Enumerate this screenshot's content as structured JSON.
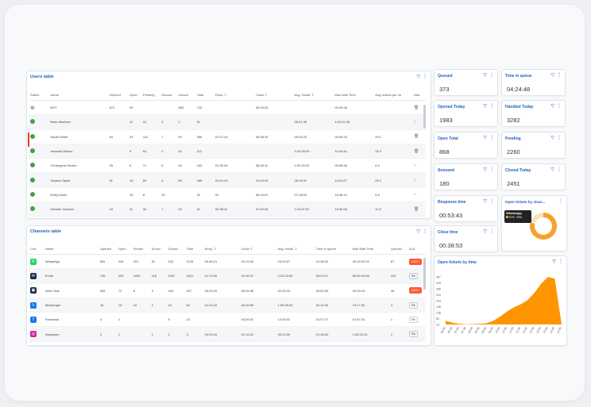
{
  "users_table": {
    "title": "Users table",
    "columns": [
      "Status",
      "Name",
      "Opened",
      "Open",
      "Pending",
      "Snooze",
      "Closed",
      "Total",
      "Resp. T.",
      "Close T.",
      "Avg. Handl. T.",
      "Max Wait Time",
      "Avg. tickets per ho",
      "Noti."
    ],
    "rows": [
      {
        "status": "globe",
        "name": "BOT",
        "opened": "672",
        "open": "50",
        "pending": "",
        "snooze": "",
        "closed": "655",
        "total": "710",
        "resp": "",
        "close": "00:15:25",
        "avg": "",
        "max": "00:30:26",
        "avgt": "",
        "noti": "trash"
      },
      {
        "status": "online",
        "name": "Brian Martinez",
        "opened": "",
        "open": "11",
        "pending": "31",
        "snooze": "4",
        "closed": "2",
        "total": "51",
        "resp": "",
        "close": "",
        "avg": "06:21:45",
        "max": "4:22:01:36",
        "avgt": "",
        "noti": "chat"
      },
      {
        "status": "online",
        "name": "Sarah White",
        "opened": "64",
        "open": "33",
        "pending": "141",
        "snooze": "7",
        "closed": "49",
        "total": "266",
        "resp": "01:07:44",
        "close": "00:58:19",
        "avg": "09:25:23",
        "max": "00:09:15",
        "avgt": "20.1",
        "noti": "trash"
      },
      {
        "status": "online",
        "name": "Amanda Wilson",
        "opened": "",
        "open": "9",
        "pending": "64",
        "snooze": "2",
        "closed": "34",
        "total": "112",
        "resp": "",
        "close": "",
        "avg": "3:18:29:25",
        "max": "11:04:44",
        "avgt": "28.3",
        "noti": "trash"
      },
      {
        "status": "online",
        "name": "Christopher Brown",
        "opened": "33",
        "open": "6",
        "pending": "71",
        "snooze": "5",
        "closed": "26",
        "total": "109",
        "resp": "01:30:54",
        "close": "08:28:12",
        "avg": "1:00:20:20",
        "max": "00:08:46",
        "avgt": "6.9",
        "noti": "chat"
      },
      {
        "status": "online",
        "name": "Jessica Taylor",
        "opened": "61",
        "open": "18",
        "pending": "83",
        "snooze": "4",
        "closed": "59",
        "total": "168",
        "resp": "00:41:40",
        "close": "01:04:49",
        "avg": "08:15:31",
        "max": "14:41:07",
        "avgt": "25.2",
        "noti": "chat"
      },
      {
        "status": "online",
        "name": "Emily Davis",
        "opened": "",
        "open": "15",
        "pending": "8",
        "snooze": "54",
        "closed": "",
        "total": "22",
        "resp": "92",
        "close": "00:15:07",
        "avg": "07:18:00",
        "max": "18:46:14",
        "avgt": "5.6",
        "noti": "chat"
      },
      {
        "status": "online",
        "name": "Michael Johnson",
        "opened": "19",
        "open": "11",
        "pending": "40",
        "snooze": "7",
        "closed": "29",
        "total": "91",
        "resp": "00:38:31",
        "close": "01:00:26",
        "avg": "1:22:07:52",
        "max": "19:36:06",
        "avgt": "11.8",
        "noti": "trash"
      }
    ]
  },
  "channels_table": {
    "title": "Channels table",
    "columns": [
      "Cha",
      "Name",
      "Opened",
      "Open",
      "Pendin",
      "Snooz",
      "Closed",
      "Total",
      "Resp. T.",
      "Close T.",
      "Avg. Handl. T.",
      "Time in queue",
      "Max Wait Time",
      "Queued",
      "SLA"
    ],
    "rows": [
      {
        "icon": "whatsapp",
        "name": "WhatsApp",
        "opened": "581",
        "open": "249",
        "pending": "221",
        "snooze": "51",
        "closed": "513",
        "total": "1129",
        "resp": "00:46:21",
        "close": "00:19:40",
        "avg": "23:20:07",
        "queue": "01:36:32",
        "max": "00:18:32:22",
        "queued": "87",
        "sla": "2000+",
        "sla_red": true
      },
      {
        "icon": "email",
        "name": "Email",
        "opened": "746",
        "open": "490",
        "pending": "1992",
        "snooze": "118",
        "closed": "1337",
        "total": "4312",
        "resp": "01:13:39",
        "close": "01:16:37",
        "avg": "2:24:22:52",
        "queue": "00:24:47",
        "max": "60:00:44:55",
        "queued": "224",
        "sla": "0%",
        "sla_red": false
      },
      {
        "icon": "webchat",
        "name": "Web Chat",
        "opened": "526",
        "open": "72",
        "pending": "8",
        "snooze": "3",
        "closed": "444",
        "total": "527",
        "resp": "00:33:29",
        "close": "00:24:35",
        "avg": "02:45:15",
        "queue": "00:52:09",
        "max": "00:09:15",
        "queued": "46",
        "sla": "2000+",
        "sla_red": true
      },
      {
        "icon": "messenger",
        "name": "Messenger",
        "opened": "16",
        "open": "15",
        "pending": "15",
        "snooze": "2",
        "closed": "22",
        "total": "54",
        "resp": "01:24:22",
        "close": "00:16:59",
        "avg": "1:09:39:54",
        "queue": "02:11:09",
        "max": "19:17:32",
        "queued": "4",
        "sla": "0%",
        "sla_red": false
      },
      {
        "icon": "facebook",
        "name": "Facebook",
        "opened": "3",
        "open": "1",
        "pending": "",
        "snooze": "",
        "closed": "9",
        "total": "10",
        "resp": "",
        "close": "04:26:02",
        "avg": "12:04:02",
        "queue": "01:57:17",
        "max": "01:57:24",
        "queued": "1",
        "sla": "0%",
        "sla_red": false
      },
      {
        "icon": "instagram",
        "name": "Instagram",
        "opened": "2",
        "open": "1",
        "pending": "",
        "snooze": "1",
        "closed": "2",
        "total": "4",
        "resp": "00:24:44",
        "close": "01:14:22",
        "avg": "00:13:30",
        "queue": "01:48:50",
        "max": "1:09:23:10",
        "queued": "1",
        "sla": "0%",
        "sla_red": false
      }
    ]
  },
  "metrics": [
    {
      "label": "Queued",
      "value": "373"
    },
    {
      "label": "Time in queue",
      "value": "04:24:48"
    },
    {
      "label": "Opened Today",
      "value": "1983"
    },
    {
      "label": "Handled Today",
      "value": "3282"
    },
    {
      "label": "Open Total",
      "value": "868"
    },
    {
      "label": "Pending",
      "value": "2260"
    },
    {
      "label": "Snoozed",
      "value": "180"
    },
    {
      "label": "Closed Today",
      "value": "2451"
    },
    {
      "label": "Response time",
      "value": "00:53:43"
    },
    {
      "label": "Close time",
      "value": "00:38:53"
    }
  ],
  "donut": {
    "title": "Open tickets by chan...",
    "tooltip_title": "WhatsApp",
    "tooltip_value": "579: 79%",
    "fraction": 0.79,
    "color": "#f7a12c"
  },
  "chart_data": {
    "type": "area",
    "title": "Open tickets by time",
    "ytick_labels": [
      "487",
      "425",
      "368",
      "310",
      "253",
      "195",
      "138",
      "80",
      "23"
    ],
    "x": [
      "06:00",
      "06:30",
      "07:00",
      "07:30",
      "08:00",
      "08:30",
      "09:00",
      "09:30",
      "10:00",
      "10:30",
      "11:00",
      "11:30",
      "12:00",
      "12:30",
      "13:00",
      "13:30",
      "14:00",
      "14:30"
    ],
    "values": [
      60,
      40,
      30,
      25,
      28,
      30,
      35,
      60,
      100,
      150,
      190,
      220,
      260,
      330,
      420,
      487,
      470,
      20
    ],
    "ylim": [
      23,
      487
    ],
    "color": "#ff9500"
  },
  "icons": {
    "filter": "▽",
    "more": "⋮"
  }
}
